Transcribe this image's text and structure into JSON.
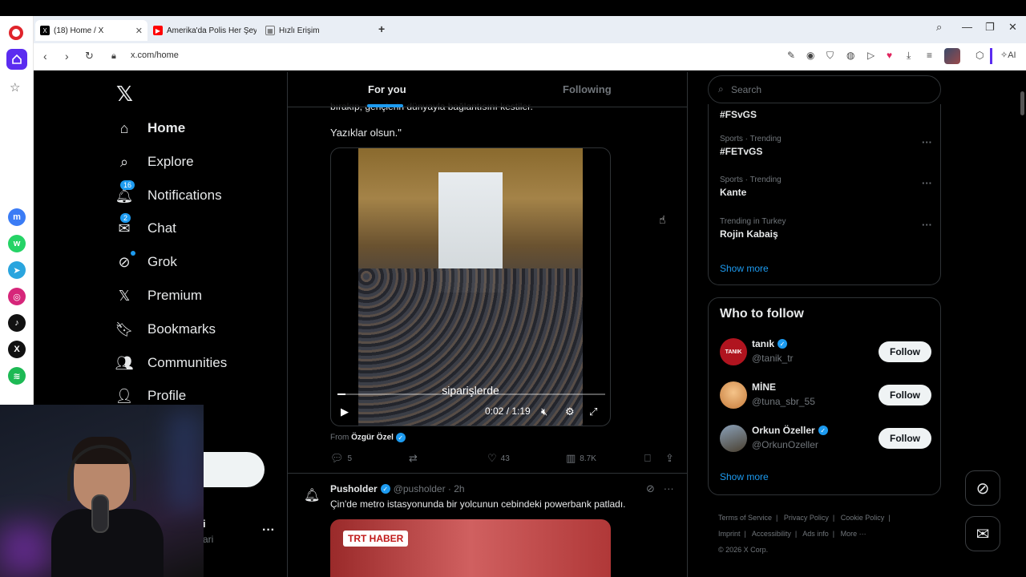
{
  "browser": {
    "tabs": [
      {
        "label": "(18) Home / X",
        "active": true
      },
      {
        "label": "Amerika'da Polis Her Şeyi",
        "active": false
      },
      {
        "label": "Hızlı Erişim",
        "active": false
      }
    ],
    "new_tab_label": "+",
    "url": "x.com/home",
    "ai_label": "AI"
  },
  "opera_sidebar": {
    "apps": [
      "messenger-icon",
      "whatsapp-icon",
      "telegram-icon",
      "instagram-icon",
      "tiktok-icon",
      "x-icon",
      "spotify-icon"
    ]
  },
  "nav": {
    "items": [
      {
        "label": "Home",
        "icon": "home-icon",
        "bold": true
      },
      {
        "label": "Explore",
        "icon": "search-icon"
      },
      {
        "label": "Notifications",
        "icon": "bell-icon",
        "badge": "16"
      },
      {
        "label": "Chat",
        "icon": "mail-icon",
        "badge": "2"
      },
      {
        "label": "Grok",
        "icon": "grok-icon"
      },
      {
        "label": "Premium",
        "icon": "x-icon"
      },
      {
        "label": "Bookmarks",
        "icon": "bookmark-icon"
      },
      {
        "label": "Communities",
        "icon": "communities-icon"
      },
      {
        "label": "Profile",
        "icon": "person-icon"
      }
    ],
    "account_name_fragment": "i",
    "account_handle_fragment": "ari",
    "account_more": "···"
  },
  "feed": {
    "tabs": [
      "For you",
      "Following"
    ],
    "tweet1": {
      "text_fragment": "bırakıp, gençlerin dünyayla bağlantısını kestiler.",
      "text": "Yazıklar olsun.\"",
      "video_subtitle": "siparişlerde",
      "video_time": "0:02 / 1:19",
      "video_progress": 0.03,
      "from_label": "From",
      "from_name": "Özgür Özel",
      "stats": {
        "replies": "5",
        "likes": "43",
        "views": "8.7K"
      }
    },
    "tweet2": {
      "name": "Pusholder",
      "handle": "@pusholder",
      "time": "· 2h",
      "text": "Çin'de metro istasyonunda bir yolcunun cebindeki powerbank patladı.",
      "media_label": "TRT HABER"
    }
  },
  "search": {
    "placeholder": "Search"
  },
  "trends": {
    "top_partial": "#FSvGS",
    "items": [
      {
        "category": "Sports · Trending",
        "title": "#FETvGS"
      },
      {
        "category": "Sports · Trending",
        "title": "Kante"
      },
      {
        "category": "Trending in Turkey",
        "title": "Rojin Kabaiş"
      }
    ],
    "show_more": "Show more"
  },
  "who_to_follow": {
    "title": "Who to follow",
    "users": [
      {
        "name": "tanık",
        "handle": "@tanik_tr",
        "verified": true,
        "avatar_text": "TANIK",
        "avatar_color": "#b0141f"
      },
      {
        "name": "MİNE",
        "handle": "@tuna_sbr_55",
        "verified": false,
        "avatar_text": "",
        "avatar_color": "#e9b06a"
      },
      {
        "name": "Orkun Özeller",
        "handle": "@OrkunOzeller",
        "verified": true,
        "avatar_text": "",
        "avatar_color": "#5e6a7a"
      }
    ],
    "follow_label": "Follow",
    "show_more": "Show more"
  },
  "footer": {
    "links": [
      "Terms of Service",
      "|",
      "Privacy Policy",
      "|",
      "Cookie Policy",
      "|",
      "Imprint",
      "|",
      "Accessibility",
      "|",
      "Ads info",
      "|",
      "More ···"
    ],
    "copyright": "© 2026 X Corp."
  },
  "colors": {
    "accent": "#1d9bf0",
    "background": "#000000",
    "border": "#2f3336",
    "muted": "#71767b"
  }
}
